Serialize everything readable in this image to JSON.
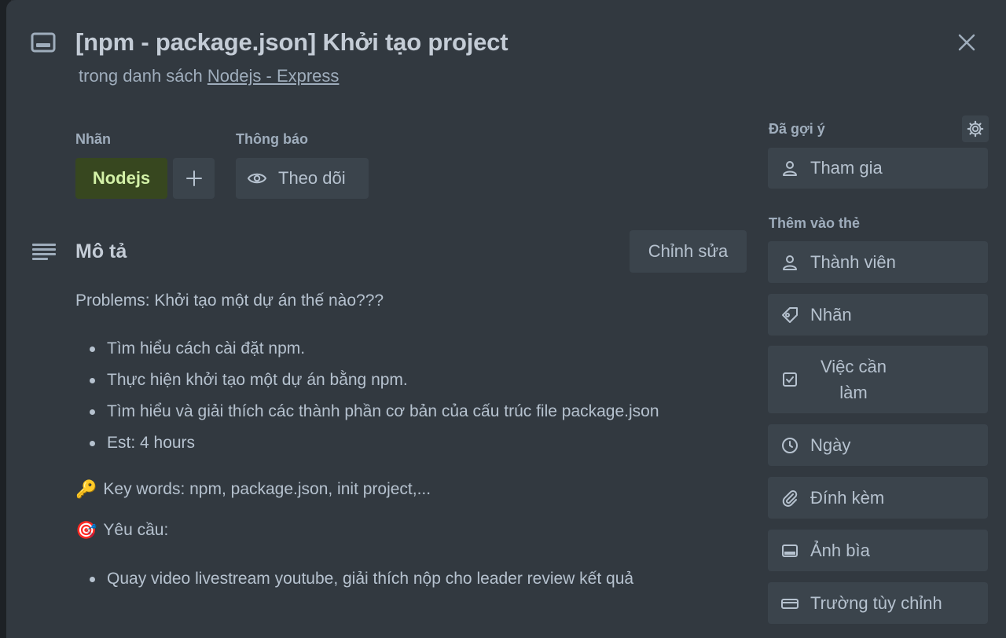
{
  "card": {
    "title": "[npm - package.json] Khởi tạo project",
    "list_prefix": "trong danh sách",
    "list_name": "Nodejs - Express"
  },
  "labels": {
    "heading": "Nhãn",
    "items": [
      {
        "name": "Nodejs",
        "color": "#37471f",
        "text_color": "#d3f1a7"
      }
    ],
    "add_icon": "plus-icon"
  },
  "notifications": {
    "heading": "Thông báo",
    "watch_label": "Theo dõi"
  },
  "description": {
    "heading": "Mô tả",
    "edit_label": "Chỉnh sửa",
    "problem": "Problems: Khởi tạo một dự án thế nào???",
    "bullets": [
      "Tìm hiểu cách cài đặt npm.",
      "Thực hiện khởi tạo một dự án bằng npm.",
      "Tìm hiểu và giải thích các thành phần cơ bản của cấu trúc file package.json",
      "Est: 4 hours"
    ],
    "keywords_emoji": "🔑",
    "keywords": "Key words: npm, package.json, init project,...",
    "requirements_emoji": "🎯",
    "requirements_heading": "Yêu cầu:",
    "requirements": [
      "Quay video livestream youtube, giải thích nộp cho leader review kết quả"
    ]
  },
  "sidebar": {
    "suggested_heading": "Đã gợi ý",
    "join_label": "Tham gia",
    "add_to_card_heading": "Thêm vào thẻ",
    "items": [
      {
        "label": "Thành viên",
        "icon": "person-icon"
      },
      {
        "label": "Nhãn",
        "icon": "tag-icon"
      },
      {
        "label": "Việc cần làm",
        "icon": "checklist-icon"
      },
      {
        "label": "Ngày",
        "icon": "clock-icon"
      },
      {
        "label": "Đính kèm",
        "icon": "paperclip-icon"
      },
      {
        "label": "Ảnh bìa",
        "icon": "cover-icon"
      },
      {
        "label": "Trường tùy chỉnh",
        "icon": "custom-field-icon"
      }
    ]
  },
  "colors": {
    "modal_bg": "#323940",
    "button_bg": "#3b444c",
    "text": "#b6c2cf"
  }
}
